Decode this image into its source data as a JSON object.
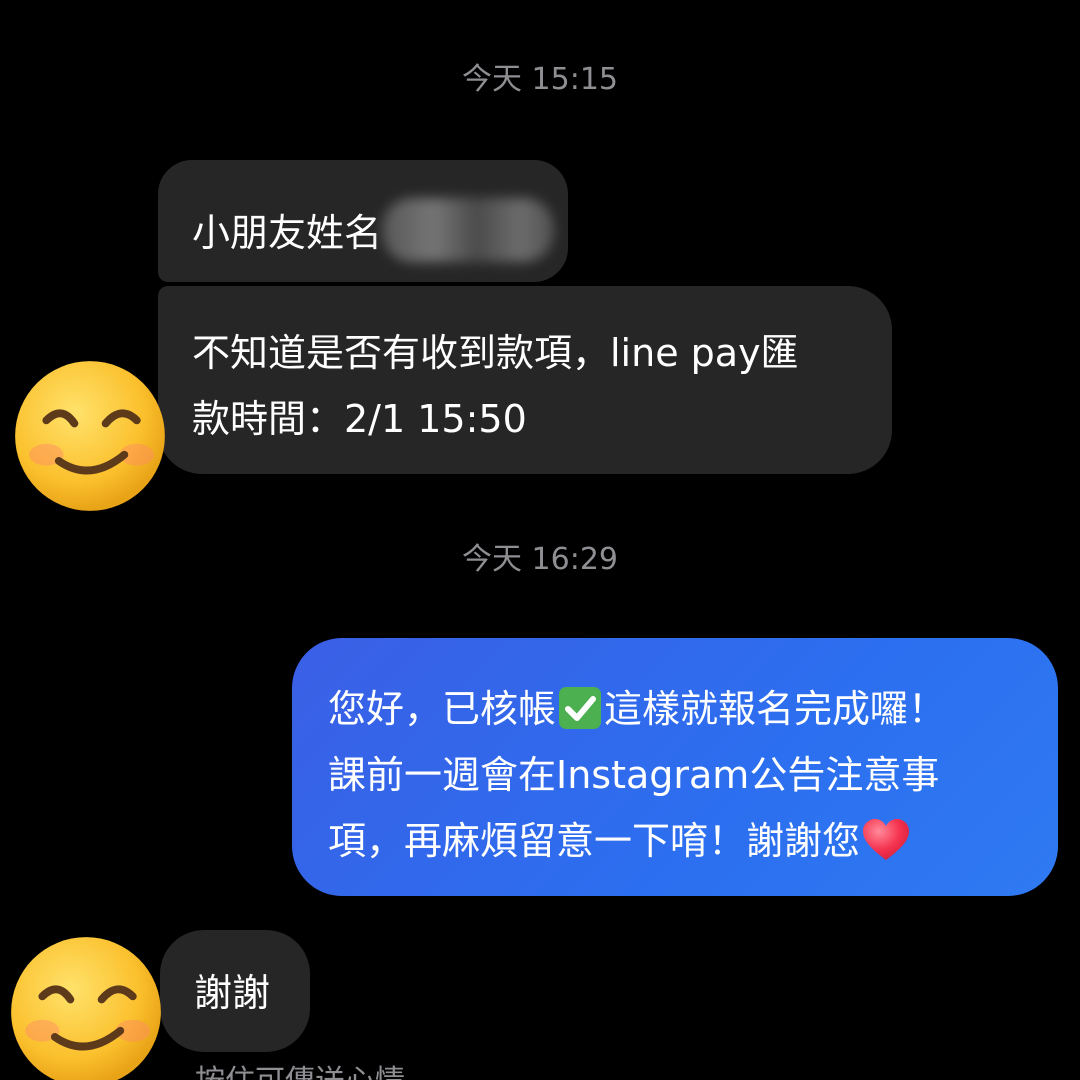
{
  "conversation": {
    "timestamp_1": "今天 15:15",
    "timestamp_2": "今天 16:29",
    "messages": [
      {
        "sender": "them",
        "text": "小朋友姓名"
      },
      {
        "sender": "them",
        "line1": "不知道是否有收到款項，line pay匯",
        "line2": "款時間：2/1 15:50"
      },
      {
        "sender": "me",
        "line1_a": "您好，已核帳",
        "line1_b": "這樣就報名完成囉！",
        "line2": "課前一週會在Instagram公告注意事",
        "line3": "項，再麻煩留意一下唷！謝謝您"
      },
      {
        "sender": "them",
        "text": "謝謝"
      }
    ],
    "partial_bottom_text": "按住可傳送心情"
  },
  "icons": {
    "avatar": "smiling-face-emoji",
    "check": "white-heavy-check-mark",
    "heart": "red-heart"
  },
  "colors": {
    "background": "#000000",
    "incoming_bubble": "#262626",
    "outgoing_bubble": "#3a64e8",
    "timestamp": "#8e8e93"
  }
}
